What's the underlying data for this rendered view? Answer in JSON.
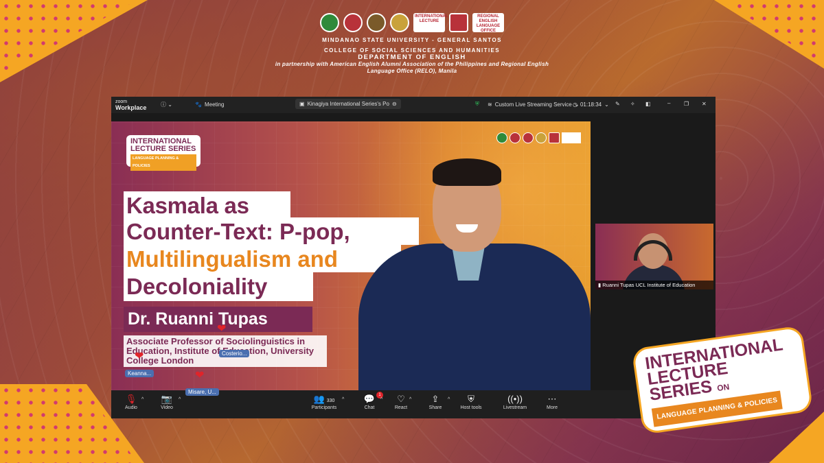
{
  "header": {
    "logos": [
      "university-seal",
      "college-seal",
      "department-seal",
      "seal-4",
      "international-lecture-logo",
      "relo-logo",
      "regional-english-language-office-logo"
    ],
    "line1": "MINDANAO STATE UNIVERSITY - GENERAL SANTOS",
    "line2": "COLLEGE OF SOCIAL SCIENCES AND HUMANITIES",
    "line3": "DEPARTMENT OF ENGLISH",
    "partnership": "in partnership with American English Alumni Association of the Philippines and Regional English Language Office (RELO), Manila",
    "logo_text_ils": "INTERNATIONAL LECTURE",
    "logo_text_relo": "REGIONAL ENGLISH LANGUAGE OFFICE"
  },
  "zoom": {
    "brand_top": "zoom",
    "brand_bottom": "Workplace",
    "meeting_tab": "Meeting",
    "share_tab": "Kinagiya International Series's Po",
    "streaming": "Custom Live Streaming Service",
    "timer": "01:18:34"
  },
  "slide": {
    "badge_line1": "INTERNATIONAL",
    "badge_line2": "LECTURE SERIES",
    "badge_sub": "LANGUAGE PLANNING & POLICIES",
    "title_line1": "Kasmala as",
    "title_line2": "Counter-Text: P-pop,",
    "title_line3": "Multilingualism and",
    "title_line4": "Decoloniality",
    "speaker": "Dr. Ruanni Tupas",
    "affiliation": "Associate Professor of Sociolinguistics in Education, Institute of Education, University College London"
  },
  "reactions": [
    {
      "name": "Costerio..."
    },
    {
      "name": "Keanna..."
    },
    {
      "name": "Misare, U..."
    }
  ],
  "thumbnail": {
    "label": "Ruanni Tupas UCL Institute of Education"
  },
  "controls": {
    "audio": "Audio",
    "video": "Video",
    "participants": "Participants",
    "participants_count": "330",
    "chat": "Chat",
    "chat_badge": "1",
    "react": "React",
    "share": "Share",
    "host_tools": "Host tools",
    "livestream": "Livestream",
    "more": "More"
  },
  "overlay_badge": {
    "line1": "INTERNATIONAL",
    "line2": "LECTURE SERIES",
    "on": "ON",
    "sub": "LANGUAGE PLANNING & POLICIES"
  },
  "colors": {
    "brand_purple": "#7b2a55",
    "brand_orange": "#f5a623",
    "zoom_dark": "#1f1f1f",
    "reaction_red": "#e0242a"
  }
}
